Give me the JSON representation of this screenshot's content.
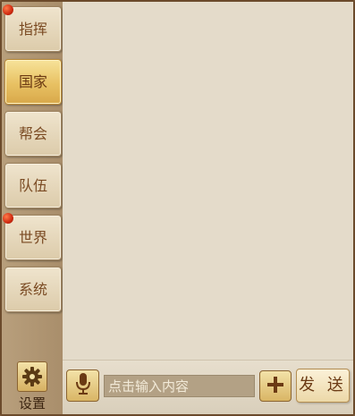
{
  "sidebar": {
    "tabs": [
      {
        "label": "指挥",
        "has_notification": true
      },
      {
        "label": "国家",
        "active": true
      },
      {
        "label": "帮会"
      },
      {
        "label": "队伍"
      },
      {
        "label": "世界",
        "has_notification": true
      },
      {
        "label": "系统"
      }
    ],
    "settings": {
      "label": "设置",
      "icon": "gear-icon"
    }
  },
  "input": {
    "placeholder": "点击输入内容"
  },
  "buttons": {
    "mic_icon": "microphone-icon",
    "plus_icon": "plus-icon",
    "send_label": "发 送"
  },
  "colors": {
    "active_tab": "#e8c163",
    "notification_dot": "#d02a10",
    "chat_background": "#e4dbca"
  }
}
